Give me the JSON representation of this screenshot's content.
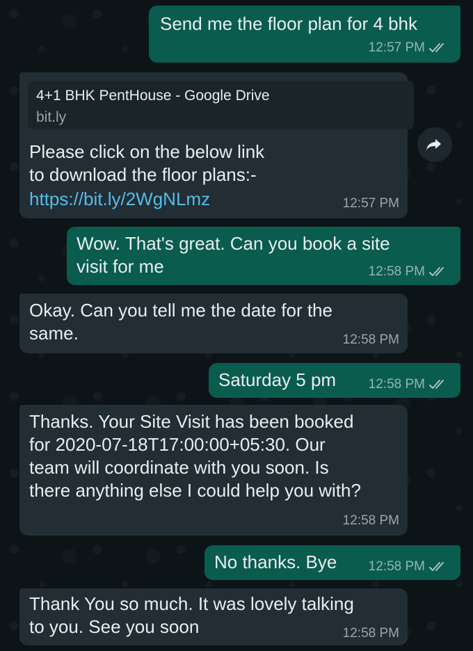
{
  "messages": [
    {
      "direction": "outgoing",
      "text": "Send me the floor plan for 4 bhk",
      "time": "12:57 PM",
      "status_icon": "double-check-icon"
    },
    {
      "direction": "incoming",
      "link_preview": {
        "title": "4+1 BHK PentHouse - Google Drive",
        "domain": "bit.ly"
      },
      "text": "Please click on the below link\nto download the floor plans:-",
      "link": "https://bit.ly/2WgNLmz",
      "time": "12:57 PM"
    },
    {
      "direction": "outgoing",
      "text": "Wow. That's great. Can you book a site\nvisit for me",
      "time": "12:58 PM",
      "status_icon": "double-check-icon"
    },
    {
      "direction": "incoming",
      "text": "Okay. Can you tell me the date for the\nsame.",
      "time": "12:58 PM"
    },
    {
      "direction": "outgoing",
      "text": "Saturday 5 pm",
      "time": "12:58 PM",
      "status_icon": "double-check-icon"
    },
    {
      "direction": "incoming",
      "text": "Thanks. Your Site Visit has been booked\nfor 2020-07-18T17:00:00+05:30. Our\nteam will coordinate with you soon. Is\nthere anything else I could help you with?",
      "time": "12:58 PM"
    },
    {
      "direction": "outgoing",
      "text": "No thanks. Bye",
      "time": "12:58 PM",
      "status_icon": "double-check-icon"
    },
    {
      "direction": "incoming",
      "text": "Thank You so much. It was lovely talking\nto you. See you soon",
      "time": "12:58 PM"
    }
  ],
  "forward_icon": "forward-arrow-icon",
  "colors": {
    "background": "#0d1418",
    "outgoing_bubble": "#0a5c4f",
    "incoming_bubble": "#222d34",
    "text": "#e9edef",
    "link": "#53bdeb"
  }
}
